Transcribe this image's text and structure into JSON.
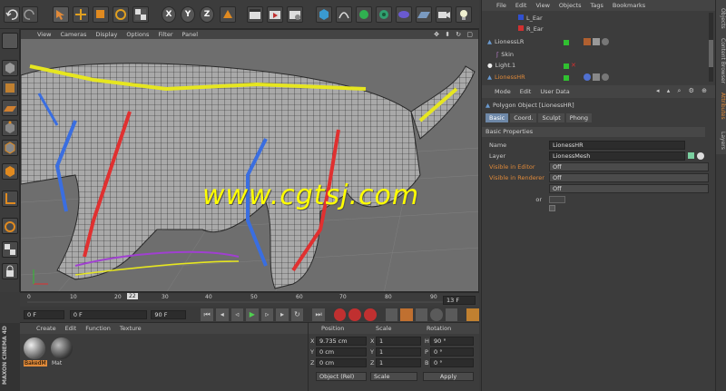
{
  "viewport": {
    "menu": [
      "View",
      "Cameras",
      "Display",
      "Options",
      "Filter",
      "Panel"
    ]
  },
  "toolbar": {
    "axis_x": "X",
    "axis_y": "Y",
    "axis_z": "Z"
  },
  "watermark": "www.cgtsj.com",
  "object_manager": {
    "menu": [
      "File",
      "Edit",
      "View",
      "Objects",
      "Tags",
      "Bookmarks"
    ],
    "items": [
      {
        "name": "L_Ear"
      },
      {
        "name": "R_Ear"
      },
      {
        "name": "LionessLR"
      },
      {
        "name": "Skin"
      },
      {
        "name": "Light.1"
      },
      {
        "name": "LionessHR"
      }
    ]
  },
  "attributes": {
    "menu": [
      "Mode",
      "Edit",
      "User Data"
    ],
    "title": "Polygon Object [LionessHR]",
    "tabs": [
      "Basic",
      "Coord.",
      "Sculpt",
      "Phong"
    ],
    "section": "Basic Properties",
    "rows": [
      {
        "label": "Name",
        "value": "LionessHR"
      },
      {
        "label": "Layer",
        "value": "LionessMesh"
      },
      {
        "label": "Visible in Editor",
        "value": "Off"
      },
      {
        "label": "Visible in Renderer",
        "value": "Off"
      },
      {
        "label": "",
        "value": "Off"
      },
      {
        "label": "or",
        "value": ""
      }
    ]
  },
  "side_tabs": [
    "Objects",
    "Content Browser",
    "Attributes",
    "Layers"
  ],
  "timeline": {
    "ticks": [
      "0",
      "10",
      "20",
      "22",
      "30",
      "40",
      "50",
      "60",
      "70",
      "80",
      "90"
    ],
    "current_frame": "22",
    "end_label": "13 F",
    "start_field": "0 F",
    "min_field": "0 F",
    "max_field": "90 F",
    "end_field": "90 F"
  },
  "material_manager": {
    "menu": [
      "Create",
      "Edit",
      "Function",
      "Texture"
    ],
    "materials": [
      "BakedM",
      "Mat"
    ]
  },
  "brand": {
    "line1": "MAXON",
    "line2": "CINEMA 4D"
  },
  "coordinates": {
    "headers": [
      "Position",
      "Scale",
      "Rotation"
    ],
    "rows": [
      {
        "axis": "X",
        "pos": "9.735 cm",
        "scale_axis": "X",
        "scale": "1",
        "rot_axis": "H",
        "rot": "90 °"
      },
      {
        "axis": "Y",
        "pos": "0 cm",
        "scale_axis": "Y",
        "scale": "1",
        "rot_axis": "P",
        "rot": "0 °"
      },
      {
        "axis": "Z",
        "pos": "0 cm",
        "scale_axis": "Z",
        "scale": "1",
        "rot_axis": "B",
        "rot": "0 °"
      }
    ],
    "mode": "Object (Rel)",
    "scale_mode": "Scale",
    "apply": "Apply"
  },
  "colors": {
    "bg": "#3a3a3a",
    "panel": "#3e3e3e",
    "accent_blue": "#6e88a8",
    "watermark": "#ffff00",
    "wireframe": "#1f1f1f",
    "bone_red": "#e03030",
    "bone_blue": "#3a6ee0",
    "bone_yellow": "#e6e620"
  }
}
